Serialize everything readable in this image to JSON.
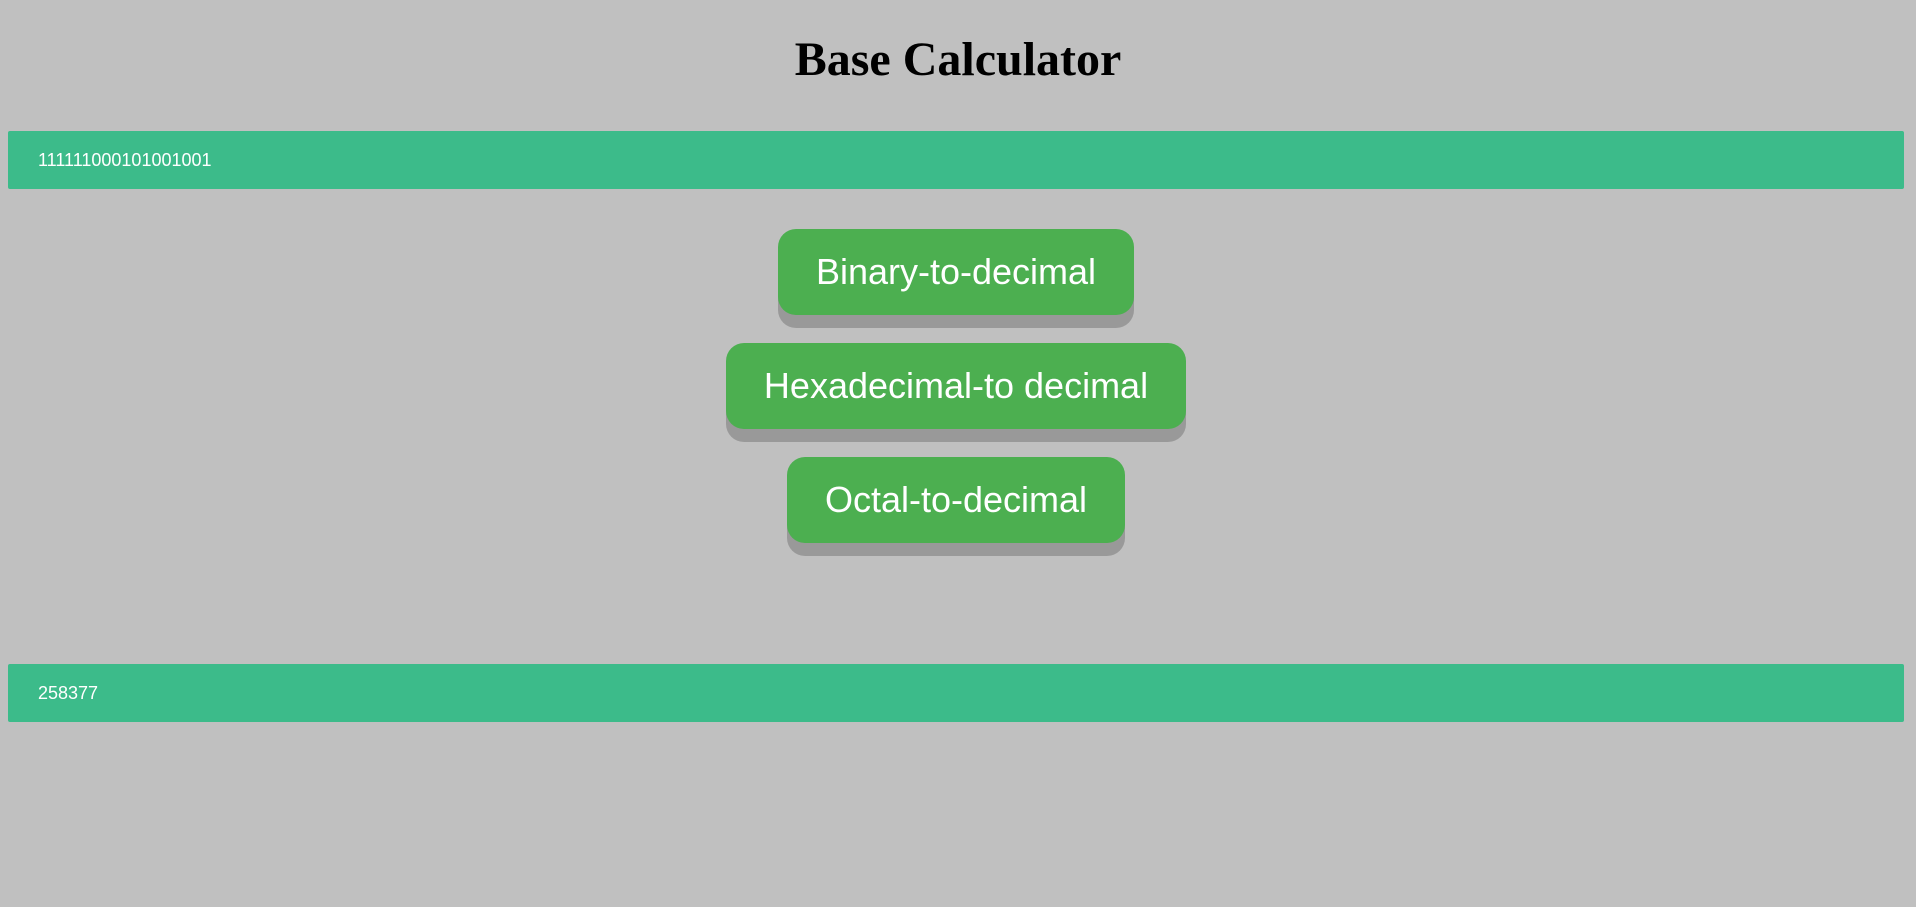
{
  "page": {
    "title": "Base Calculator"
  },
  "input": {
    "value": "111111000101001001"
  },
  "buttons": {
    "binary_label": "Binary-to-decimal",
    "hex_label": "Hexadecimal-to decimal",
    "octal_label": "Octal-to-decimal"
  },
  "output": {
    "value": "258377"
  },
  "colors": {
    "background": "#c0c0c0",
    "field": "#3cbb8a",
    "button": "#4caf50",
    "button_shadow": "#999999",
    "text_light": "#ffffff"
  }
}
